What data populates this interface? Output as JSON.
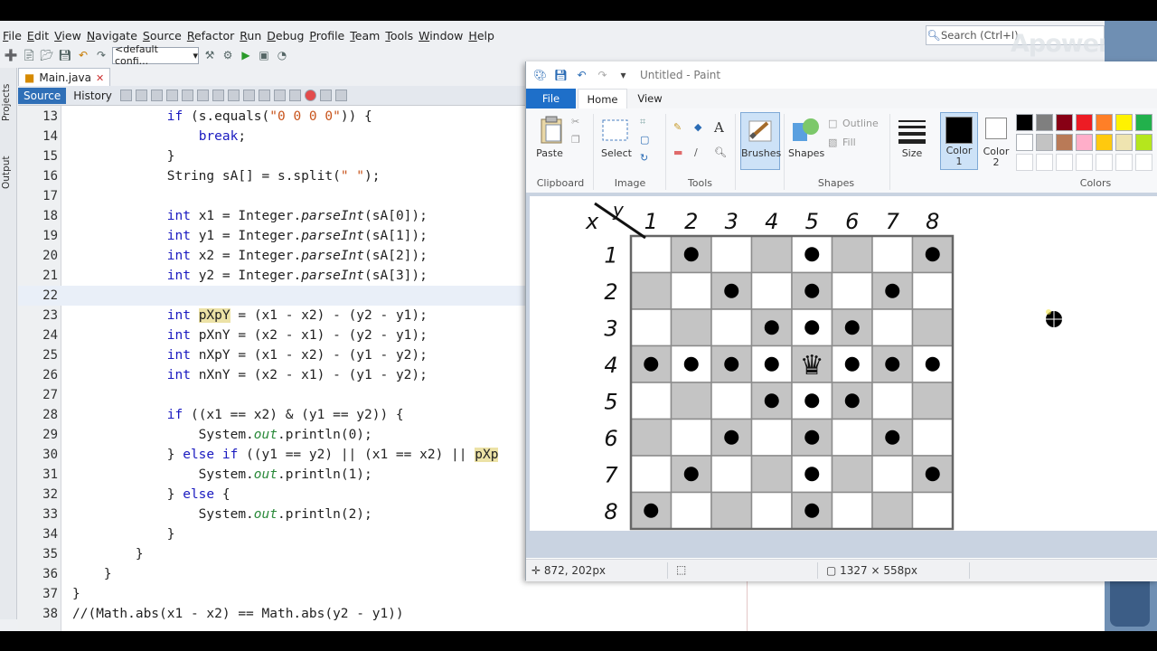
{
  "ide": {
    "menus": [
      "File",
      "Edit",
      "View",
      "Navigate",
      "Source",
      "Refactor",
      "Run",
      "Debug",
      "Profile",
      "Team",
      "Tools",
      "Window",
      "Help"
    ],
    "search_placeholder": "Search (Ctrl+I)",
    "config": "<default confi...",
    "file_tab": "Main.java",
    "subtabs": {
      "source": "Source",
      "history": "History"
    },
    "side_tabs": {
      "projects": "Projects",
      "output": "Output"
    },
    "code_lines": [
      {
        "n": "13",
        "html": "            <span class=\"kw\">if</span> (s.equals(<span class=\"str\">\"0 0 0 0\"</span>)) {"
      },
      {
        "n": "14",
        "html": "                <span class=\"kw\">break</span>;"
      },
      {
        "n": "15",
        "html": "            }"
      },
      {
        "n": "16",
        "html": "            String sA[] = s.split(<span class=\"str\">\" \"</span>);"
      },
      {
        "n": "17",
        "html": ""
      },
      {
        "n": "18",
        "html": "            <span class=\"kw\">int</span> x1 = Integer.<span class=\"it\">parseInt</span>(sA[0]);"
      },
      {
        "n": "19",
        "html": "            <span class=\"kw\">int</span> y1 = Integer.<span class=\"it\">parseInt</span>(sA[1]);"
      },
      {
        "n": "20",
        "html": "            <span class=\"kw\">int</span> x2 = Integer.<span class=\"it\">parseInt</span>(sA[2]);"
      },
      {
        "n": "21",
        "html": "            <span class=\"kw\">int</span> y2 = Integer.<span class=\"it\">parseInt</span>(sA[3]);"
      },
      {
        "n": "22",
        "html": ""
      },
      {
        "n": "23",
        "html": "            <span class=\"kw\">int</span> <span class=\"var\">pXpY</span> = (x1 - x2) - (y2 - y1);"
      },
      {
        "n": "24",
        "html": "            <span class=\"kw\">int</span> pXnY = (x2 - x1) - (y2 - y1);"
      },
      {
        "n": "25",
        "html": "            <span class=\"kw\">int</span> nXpY = (x1 - x2) - (y1 - y2);"
      },
      {
        "n": "26",
        "html": "            <span class=\"kw\">int</span> nXnY = (x2 - x1) - (y1 - y2);"
      },
      {
        "n": "27",
        "html": ""
      },
      {
        "n": "28",
        "html": "            <span class=\"kw\">if</span> ((x1 == x2) &amp; (y1 == y2)) {"
      },
      {
        "n": "29",
        "html": "                System.<span class=\"fld\">out</span>.println(0);"
      },
      {
        "n": "30",
        "html": "            } <span class=\"kw\">else if</span> ((y1 == y2) || (x1 == x2) || <span class=\"var\">pXp</span>"
      },
      {
        "n": "31",
        "html": "                System.<span class=\"fld\">out</span>.println(1);"
      },
      {
        "n": "32",
        "html": "            } <span class=\"kw\">else</span> {"
      },
      {
        "n": "33",
        "html": "                System.<span class=\"fld\">out</span>.println(2);"
      },
      {
        "n": "34",
        "html": "            }"
      },
      {
        "n": "35",
        "html": "        }"
      },
      {
        "n": "36",
        "html": "    }"
      },
      {
        "n": "37",
        "html": "}"
      },
      {
        "n": "38",
        "html": "//(Math.abs(x1 - x2) == Math.abs(y2 - y1))"
      }
    ],
    "watermark": "Apowersoft"
  },
  "paint": {
    "title": "Untitled - Paint",
    "tabs": {
      "file": "File",
      "home": "Home",
      "view": "View"
    },
    "ribbon": {
      "paste": "Paste",
      "clipboard": "Clipboard",
      "select": "Select",
      "image": "Image",
      "tools": "Tools",
      "brushes": "Brushes",
      "shapes": "Shapes",
      "outline": "Outline",
      "fill": "Fill",
      "shapes_group": "Shapes",
      "size": "Size",
      "color1": "Color\n1",
      "color2": "Color\n2",
      "colors": "Colors"
    },
    "palette": [
      "#000000",
      "#7f7f7f",
      "#880015",
      "#ed1c24",
      "#ff7f27",
      "#fff200",
      "#22b14c",
      "#ffffff",
      "#c3c3c3",
      "#b97a57",
      "#ffaec9",
      "#ffc90e",
      "#efe4b0",
      "#b5e61d"
    ],
    "status": {
      "cursor": "872, 202px",
      "size": "1327 × 558px"
    },
    "board": {
      "col_labels": [
        "1",
        "2",
        "3",
        "4",
        "5",
        "6",
        "7",
        "8"
      ],
      "row_labels": [
        "1",
        "2",
        "3",
        "4",
        "5",
        "6",
        "7",
        "8"
      ],
      "axis_x": "x",
      "axis_y": "y",
      "queen_row": 4,
      "queen_col": 5,
      "dots": [
        [
          1,
          2
        ],
        [
          1,
          5
        ],
        [
          1,
          8
        ],
        [
          2,
          3
        ],
        [
          2,
          5
        ],
        [
          2,
          7
        ],
        [
          3,
          4
        ],
        [
          3,
          5
        ],
        [
          3,
          6
        ],
        [
          4,
          1
        ],
        [
          4,
          2
        ],
        [
          4,
          3
        ],
        [
          4,
          4
        ],
        [
          4,
          6
        ],
        [
          4,
          7
        ],
        [
          4,
          8
        ],
        [
          5,
          4
        ],
        [
          5,
          5
        ],
        [
          5,
          6
        ],
        [
          6,
          3
        ],
        [
          6,
          5
        ],
        [
          6,
          7
        ],
        [
          7,
          2
        ],
        [
          7,
          5
        ],
        [
          7,
          8
        ],
        [
          8,
          1
        ],
        [
          8,
          5
        ]
      ]
    }
  }
}
